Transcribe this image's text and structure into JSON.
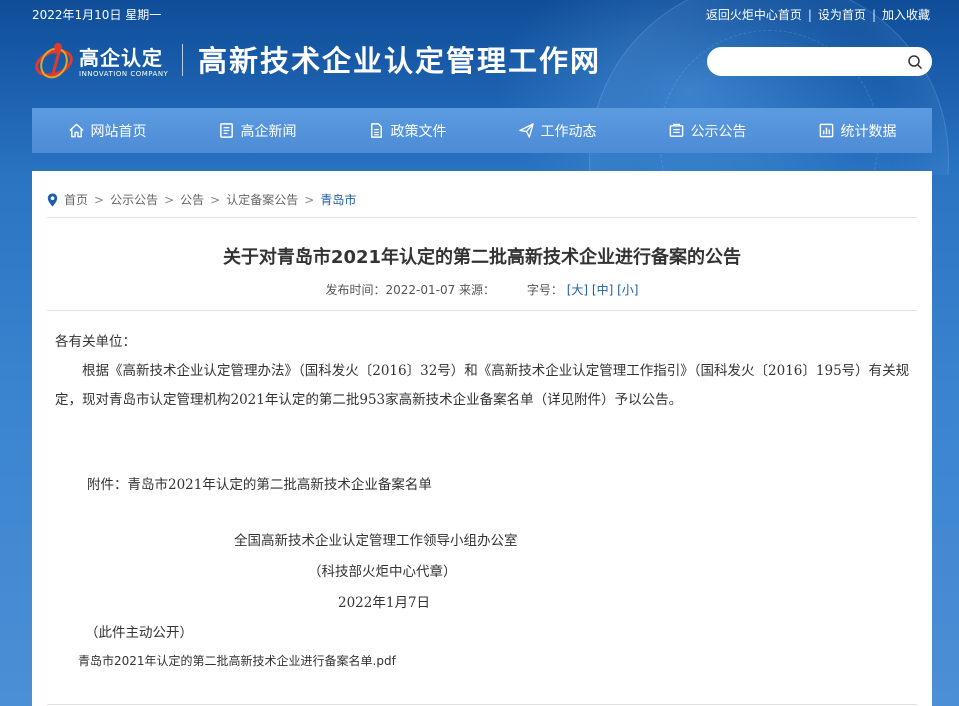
{
  "topbar": {
    "date": "2022年1月10日 星期一",
    "links": [
      "返回火炬中心首页",
      "设为首页",
      "加入收藏"
    ],
    "separator": "|"
  },
  "logo": {
    "cn": "高企认定",
    "en": "INNOVATION COMPANY"
  },
  "site_title": "高新技术企业认定管理工作网",
  "search": {
    "value": "",
    "placeholder": ""
  },
  "nav": {
    "items": [
      {
        "label": "网站首页",
        "icon": "home-icon"
      },
      {
        "label": "高企新闻",
        "icon": "news-icon"
      },
      {
        "label": "政策文件",
        "icon": "document-icon"
      },
      {
        "label": "工作动态",
        "icon": "paper-plane-icon"
      },
      {
        "label": "公示公告",
        "icon": "bulletin-icon"
      },
      {
        "label": "统计数据",
        "icon": "chart-icon"
      }
    ]
  },
  "breadcrumb": {
    "items": [
      "首页",
      "公示公告",
      "公告",
      "认定备案公告",
      "青岛市"
    ],
    "separator": ">"
  },
  "article": {
    "title": "关于对青岛市2021年认定的第二批高新技术企业进行备案的公告",
    "meta": {
      "publish_label": "发布时间：2022-01-07 来源：",
      "size_label": "字号：",
      "sizes": [
        "[大]",
        "[中]",
        "[小]"
      ]
    },
    "salutation": "各有关单位：",
    "paragraph": "根据《高新技术企业认定管理办法》（国科发火〔2016〕32号）和《高新技术企业认定管理工作指引》（国科发火〔2016〕195号）有关规定，现对青岛市认定管理机构2021年认定的第二批953家高新技术企业备案名单（详见附件）予以公告。",
    "attachment_line": "附件：青岛市2021年认定的第二批高新技术企业备案名单",
    "signature_org": "全国高新技术企业认定管理工作领导小组办公室",
    "signature_sub": "（科技部火炬中心代章）",
    "signature_date": "2022年1月7日",
    "public_note": "（此件主动公开）",
    "pdf_link": "青岛市2021年认定的第二批高新技术企业进行备案名单.pdf"
  },
  "colors": {
    "header_blue": "#1f5ea8",
    "nav_blue": "#5396dc",
    "link_blue": "#1f5ea8",
    "logo_red": "#e03a2f"
  }
}
